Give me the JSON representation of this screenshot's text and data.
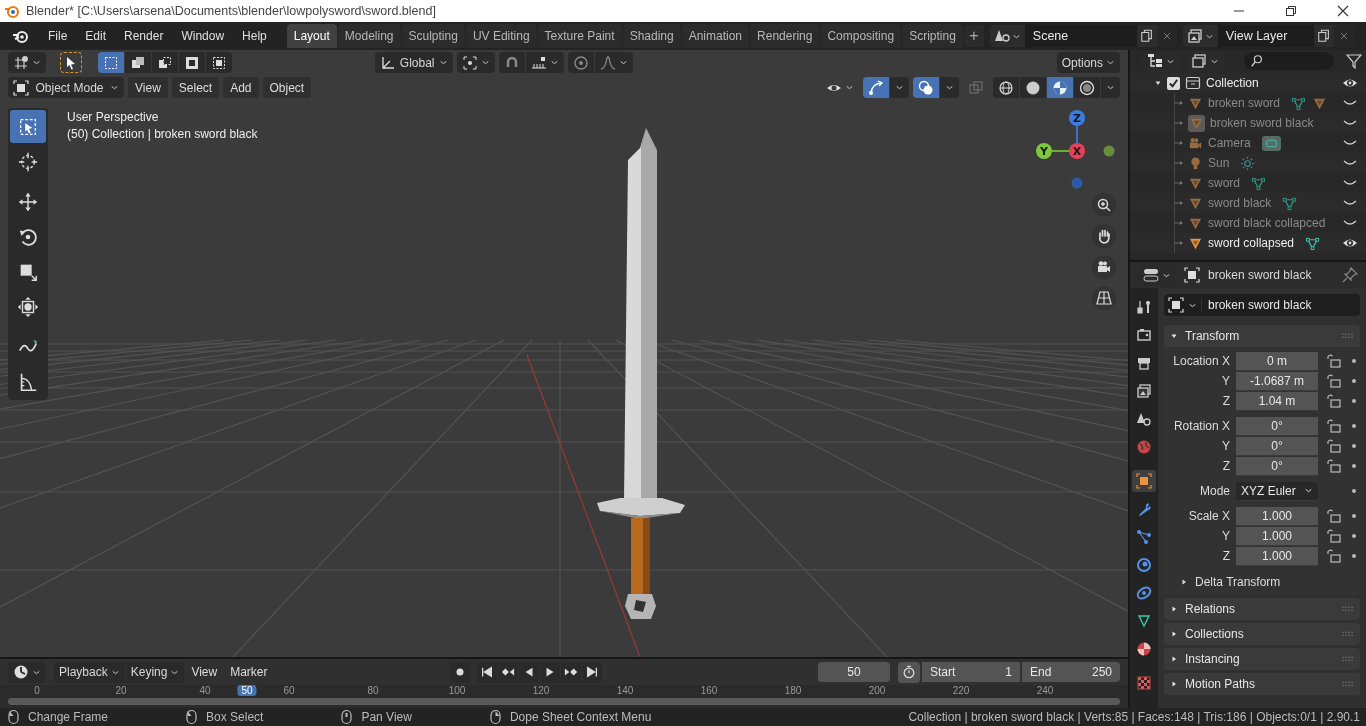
{
  "window": {
    "title": "Blender* [C:\\Users\\arsena\\Documents\\blender\\lowpolysword\\sword.blend]"
  },
  "menu": [
    "File",
    "Edit",
    "Render",
    "Window",
    "Help"
  ],
  "workspaces": [
    {
      "label": "Layout",
      "selected": true
    },
    {
      "label": "Modeling",
      "selected": false
    },
    {
      "label": "Sculpting",
      "selected": false
    },
    {
      "label": "UV Editing",
      "selected": false
    },
    {
      "label": "Texture Paint",
      "selected": false
    },
    {
      "label": "Shading",
      "selected": false
    },
    {
      "label": "Animation",
      "selected": false
    },
    {
      "label": "Rendering",
      "selected": false
    },
    {
      "label": "Compositing",
      "selected": false
    },
    {
      "label": "Scripting",
      "selected": false
    }
  ],
  "add_workspace": "+",
  "scene": {
    "value": "Scene"
  },
  "view_layer": {
    "value": "View Layer"
  },
  "viewport": {
    "select_modes": [
      {
        "selected": true
      },
      {
        "selected": false
      },
      {
        "selected": false
      },
      {
        "selected": false
      },
      {
        "selected": false
      }
    ],
    "orientation": "Global",
    "options": "Options",
    "mode": "Object Mode",
    "menu": [
      "View",
      "Select",
      "Add",
      "Object"
    ],
    "show_gizmos": true,
    "show_overlays": true,
    "xray": false,
    "shading": [
      {
        "selected": false
      },
      {
        "selected": false
      },
      {
        "selected": true
      },
      {
        "selected": false
      }
    ],
    "overlay_text": [
      "User Perspective",
      "(50) Collection | broken sword black"
    ],
    "tools": [
      {
        "selected": true
      },
      {
        "selected": false
      },
      {
        "selected": false
      },
      {
        "selected": false
      },
      {
        "selected": false
      },
      {
        "selected": false
      },
      {
        "selected": false
      },
      {
        "selected": false
      }
    ],
    "axis_labels": [
      "Z",
      "Y",
      "X"
    ]
  },
  "timeline": {
    "menus": [
      {
        "label": "Playback",
        "dropdown": true
      },
      {
        "label": "Keying",
        "dropdown": true
      },
      {
        "label": "View",
        "dropdown": false
      },
      {
        "label": "Marker",
        "dropdown": false
      }
    ],
    "current_frame": "50",
    "start_label": "Start",
    "start": "1",
    "end_label": "End",
    "end": "250",
    "ticks": [
      "0",
      "20",
      "40",
      "60",
      "80",
      "100",
      "120",
      "140",
      "160",
      "180",
      "200",
      "220",
      "240"
    ],
    "playhead": {
      "label": "50",
      "level": 0.2
    }
  },
  "outliner": {
    "collection": {
      "label": "Collection",
      "checked": true,
      "expanded": true,
      "visible": true,
      "children": [
        {
          "name": "broken sword",
          "kind": "mesh",
          "visible": false,
          "active": false,
          "data_shown": true,
          "modifier": true
        },
        {
          "name": "broken sword black",
          "kind": "mesh",
          "visible": false,
          "active": true,
          "data_shown": false,
          "modifier": false
        },
        {
          "name": "Camera",
          "kind": "camera",
          "visible": false,
          "active": false,
          "data_shown": true,
          "modifier": false
        },
        {
          "name": "Sun",
          "kind": "light",
          "visible": false,
          "active": false,
          "data_shown": true,
          "modifier": false
        },
        {
          "name": "sword",
          "kind": "mesh",
          "visible": false,
          "active": false,
          "data_shown": true,
          "modifier": false
        },
        {
          "name": "sword black",
          "kind": "mesh",
          "visible": false,
          "active": false,
          "data_shown": true,
          "modifier": false
        },
        {
          "name": "sword black collapced",
          "kind": "mesh",
          "visible": false,
          "active": false,
          "data_shown": false,
          "modifier": false
        },
        {
          "name": "sword collapsed",
          "kind": "mesh",
          "visible": true,
          "active": false,
          "data_shown": true,
          "modifier": false
        }
      ]
    }
  },
  "properties": {
    "header": "broken sword black",
    "name": "broken sword black",
    "tabs": [
      {
        "selected": false
      },
      {
        "selected": false
      },
      {
        "selected": false
      },
      {
        "selected": false
      },
      {
        "selected": false
      },
      {
        "selected": false
      },
      {
        "selected": true
      },
      {
        "selected": false
      },
      {
        "selected": false
      },
      {
        "selected": false
      },
      {
        "selected": false
      },
      {
        "selected": false
      },
      {
        "selected": false
      },
      {
        "selected": false
      }
    ],
    "transform": {
      "title": "Transform",
      "expanded": true,
      "groups": [
        {
          "rows": [
            {
              "label": "Location X",
              "value": "0 m",
              "kind": "number",
              "locked": false
            },
            {
              "label": "Y",
              "value": "-1.0687 m",
              "kind": "number",
              "locked": false
            },
            {
              "label": "Z",
              "value": "1.04 m",
              "kind": "number",
              "locked": false
            }
          ]
        },
        {
          "rows": [
            {
              "label": "Rotation X",
              "value": "0°",
              "kind": "number",
              "locked": false
            },
            {
              "label": "Y",
              "value": "0°",
              "kind": "number",
              "locked": false
            },
            {
              "label": "Z",
              "value": "0°",
              "kind": "number",
              "locked": false
            }
          ]
        },
        {
          "rows": [
            {
              "label": "Mode",
              "value": "XYZ Euler",
              "kind": "dropdown"
            }
          ]
        },
        {
          "rows": [
            {
              "label": "Scale X",
              "value": "1.000",
              "kind": "number",
              "locked": false
            },
            {
              "label": "Y",
              "value": "1.000",
              "kind": "number",
              "locked": false
            },
            {
              "label": "Z",
              "value": "1.000",
              "kind": "number",
              "locked": false
            }
          ]
        }
      ],
      "subpanels": [
        {
          "title": "Delta Transform",
          "expanded": false
        }
      ]
    },
    "panels": [
      {
        "title": "Relations",
        "expanded": false
      },
      {
        "title": "Collections",
        "expanded": false
      },
      {
        "title": "Instancing",
        "expanded": false
      },
      {
        "title": "Motion Paths",
        "expanded": false
      }
    ]
  },
  "status_bar": {
    "hints": [
      "Change Frame",
      "Box Select",
      "Pan View",
      "Dope Sheet Context Menu"
    ],
    "info": "Collection | broken sword black | Verts:85 | Faces:148 | Tris:186 | Objects:0/1 | 2.90.1"
  }
}
